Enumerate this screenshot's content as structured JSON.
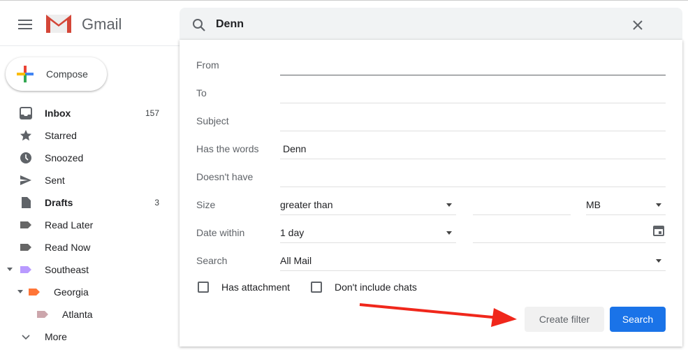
{
  "app": {
    "name": "Gmail"
  },
  "compose": {
    "label": "Compose"
  },
  "sidebar": {
    "items": [
      {
        "label": "Inbox",
        "count": "157",
        "bold": true,
        "icon": "inbox-icon"
      },
      {
        "label": "Starred",
        "icon": "star-icon"
      },
      {
        "label": "Snoozed",
        "icon": "clock-icon"
      },
      {
        "label": "Sent",
        "icon": "send-icon"
      },
      {
        "label": "Drafts",
        "count": "3",
        "bold": true,
        "icon": "draft-icon"
      },
      {
        "label": "Read Later",
        "icon": "label-icon",
        "color": "#666666"
      },
      {
        "label": "Read Now",
        "icon": "label-icon",
        "color": "#666666"
      },
      {
        "label": "Southeast",
        "icon": "label-icon",
        "color": "#b99aff"
      },
      {
        "label": "Georgia",
        "icon": "label-icon",
        "color": "#ff7537"
      },
      {
        "label": "Atlanta",
        "icon": "label-icon",
        "color": "#cca6ac"
      },
      {
        "label": "More",
        "icon": "chevron-down-icon"
      }
    ]
  },
  "search": {
    "query": "Denn"
  },
  "form": {
    "from_label": "From",
    "to_label": "To",
    "subject_label": "Subject",
    "has_words_label": "Has the words",
    "has_words_value": "Denn",
    "doesnt_have_label": "Doesn't have",
    "size_label": "Size",
    "size_op": "greater than",
    "size_unit": "MB",
    "date_label": "Date within",
    "date_value": "1 day",
    "search_label": "Search",
    "search_in": "All Mail",
    "has_attachment": "Has attachment",
    "no_chats": "Don't include chats",
    "create_filter": "Create filter",
    "search_button": "Search"
  },
  "colors": {
    "accent": "#1a73e8",
    "arrow": "#f0271b"
  }
}
